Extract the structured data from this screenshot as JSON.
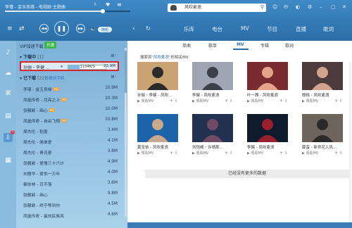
{
  "player": {
    "now_playing": "李瑾 - 金玉良缘 - 电视剧 主题曲",
    "progress": 0.78,
    "mode_label": "随机"
  },
  "search": {
    "value": "风吹麦浪",
    "icon": "search-icon"
  },
  "nav": {
    "tabs": [
      "乐库",
      "电台",
      "MV",
      "节目",
      "直播",
      "歌词"
    ]
  },
  "left": {
    "vip_label": "VIP加速下载",
    "vip_badge": "开通",
    "downloading_label": "下载中",
    "downloading_count": "[1]",
    "active_download": {
      "name": "孙俪・李健 ...",
      "speed": "1104K/S",
      "progress": 0.3,
      "size": "23.9M"
    },
    "downloaded_label": "已下载",
    "downloaded_count": "[22]",
    "phone_link": "传歌到手机",
    "tracks": [
      {
        "name": "李瑾 - 金玉良缘",
        "hq": true,
        "size": "10.9M"
      },
      {
        "name": "凤凰传奇 - 月亮之上",
        "hq": true,
        "size": "10.3M"
      },
      {
        "name": "张靓颖 - 画心",
        "hq": true,
        "size": "10.0M"
      },
      {
        "name": "凤凰传奇 - 自由飞翔",
        "hq": true,
        "size": "10.8M"
      },
      {
        "name": "周杰伦 - 稻香",
        "hq": false,
        "size": "3.4M"
      },
      {
        "name": "周杰伦 - 简单爱",
        "hq": false,
        "size": "4.1M"
      },
      {
        "name": "周杰伦 - 青花瓷",
        "hq": false,
        "size": "3.8M"
      },
      {
        "name": "张靓颖 - 爱情三十六计",
        "hq": false,
        "size": "4.9M"
      },
      {
        "name": "刘德华 - 爱你一万年",
        "hq": false,
        "size": "4.0M"
      },
      {
        "name": "蔡依林 - 日不落",
        "hq": false,
        "size": "3.6M"
      },
      {
        "name": "张靓颖 - 画心",
        "hq": false,
        "size": "9.8M"
      },
      {
        "name": "张靓颖 - 终于等到你",
        "hq": false,
        "size": "4.5M"
      },
      {
        "name": "凤凰传奇 - 最炫民族风",
        "hq": false,
        "size": "4.6M"
      }
    ]
  },
  "right": {
    "subtabs": [
      "单曲",
      "歌单",
      "MV",
      "专辑",
      "歌词"
    ],
    "active_subtab": 2,
    "related_prefix": "搜索到",
    "related_query": "\"风吹麦浪\"",
    "related_suffix": "的相关MV",
    "watch_label": "观看MV",
    "cards": [
      {
        "caption": "孙俪・李健 - 风吹...",
        "bg": "#caa372",
        "fg": "#2b2b2b"
      },
      {
        "caption": "李健 - 风吹麦浪",
        "bg": "#9fa6b3",
        "fg": "#3a3f48"
      },
      {
        "caption": "叶一茜 - 风吹麦浪",
        "bg": "#7a2b2f",
        "fg": "#e4a48b"
      },
      {
        "caption": "殷桃・风吹麦浪",
        "bg": "#4c3a3c",
        "fg": "#d2a48d"
      },
      {
        "caption": "黄圣依 - 风吹麦浪",
        "bg": "#1c63a8",
        "fg": "#c9a98e"
      },
      {
        "caption": "刘恺威・许晴那...",
        "bg": "#233150",
        "fg": "#6f4b66"
      },
      {
        "caption": "李健 - 风吹麦浪",
        "bg": "#0f1a2c",
        "fg": "#9a1f2c"
      },
      {
        "caption": "薛蛮 - 新世花儿风...",
        "bg": "#6d655c",
        "fg": "#2a2a2a"
      }
    ],
    "no_more": "已经没有更多的数据"
  }
}
